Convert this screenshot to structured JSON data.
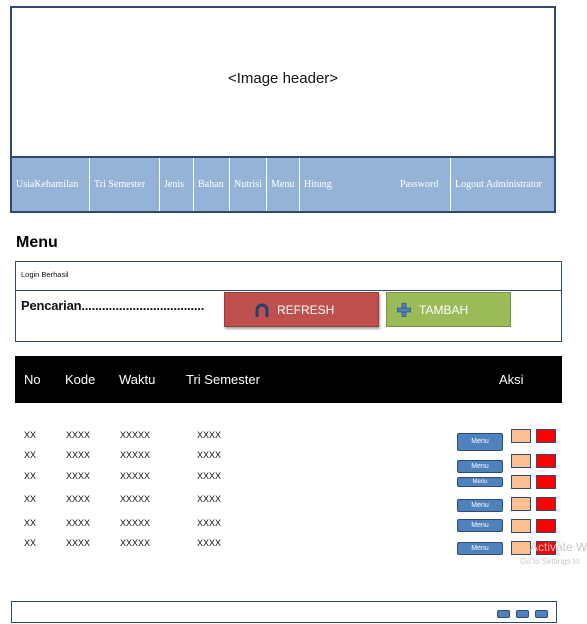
{
  "header": {
    "image_placeholder": "<Image header>"
  },
  "nav": {
    "items": [
      {
        "label": "UsiaKehamilan"
      },
      {
        "label": "Tri Semester"
      },
      {
        "label": "Jenis"
      },
      {
        "label": "Bahan"
      },
      {
        "label": "Nutrisi"
      },
      {
        "label": "Menu"
      },
      {
        "label": "Hitung"
      },
      {
        "label": "Password"
      },
      {
        "label": "Logout Administrator"
      }
    ]
  },
  "page": {
    "title": "Menu",
    "status_message": "Login Berhasil"
  },
  "search": {
    "label": "Pencarian....................................",
    "refresh_label": "REFRESH",
    "refresh_icon": "refresh-arc-icon",
    "add_label": "TAMBAH",
    "add_icon": "plus-icon"
  },
  "table": {
    "columns": [
      "No",
      "Kode",
      "Waktu",
      "Tri Semester",
      "Aksi"
    ],
    "rows": [
      {
        "no": "XX",
        "kode": "XXXX",
        "waktu": "XXXXX",
        "tri_semester": "XXXX",
        "action_label": "Menu"
      },
      {
        "no": "XX",
        "kode": "XXXX",
        "waktu": "XXXXX",
        "tri_semester": "XXXX",
        "action_label": "Menu"
      },
      {
        "no": "XX",
        "kode": "XXXX",
        "waktu": "XXXXX",
        "tri_semester": "XXXX",
        "action_label": "Menu"
      },
      {
        "no": "XX",
        "kode": "XXXX",
        "waktu": "XXXXX",
        "tri_semester": "XXXX",
        "action_label": "Menu"
      },
      {
        "no": "XX",
        "kode": "XXXX",
        "waktu": "XXXXX",
        "tri_semester": "XXXX",
        "action_label": "Menu"
      },
      {
        "no": "XX",
        "kode": "XXXX",
        "waktu": "XXXXX",
        "tri_semester": "XXXX",
        "action_label": "Menu"
      }
    ]
  },
  "watermark": {
    "title": "Activate Win",
    "subtitle": "Go to Settings to"
  },
  "colors": {
    "nav_bg": "#95b3d7",
    "refresh_bg": "#c0504d",
    "add_bg": "#9bbb59",
    "menu_button": "#4f81bd",
    "edit_button": "#fac090",
    "delete_button": "#ff0000"
  }
}
